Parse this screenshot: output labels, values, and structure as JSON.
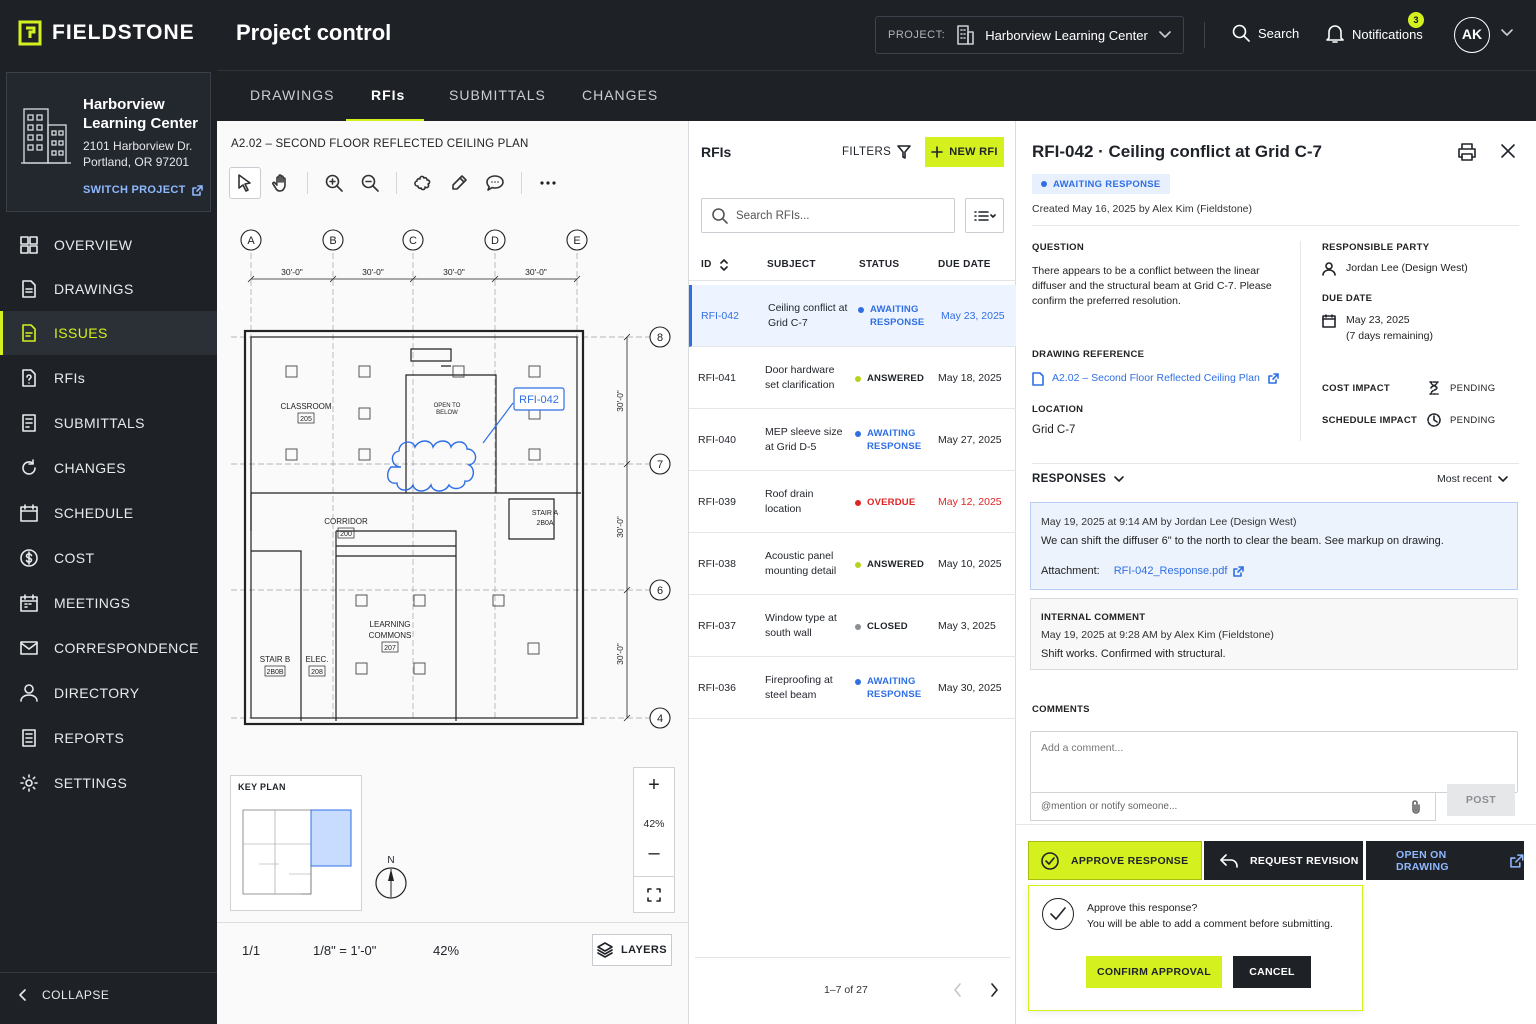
{
  "brand": {
    "name": "FIELDSTONE"
  },
  "header": {
    "title": "Project control",
    "project_label": "PROJECT:",
    "project_value": "Harborview Learning Center",
    "search": "Search",
    "notifications": "Notifications",
    "notif_count": "3",
    "avatar": "AK"
  },
  "sidebar": {
    "project_name": "Harborview Learning Center",
    "address_line1": "2101 Harborview Dr.",
    "address_line2": "Portland, OR 97201",
    "switch": "SWITCH PROJECT",
    "items": [
      {
        "label": "OVERVIEW",
        "icon": "grid-icon"
      },
      {
        "label": "DRAWINGS",
        "icon": "document-icon"
      },
      {
        "label": "ISSUES",
        "icon": "issues-icon"
      },
      {
        "label": "RFIs",
        "icon": "rfi-icon"
      },
      {
        "label": "SUBMITTALS",
        "icon": "submittal-icon"
      },
      {
        "label": "CHANGES",
        "icon": "changes-icon"
      },
      {
        "label": "SCHEDULE",
        "icon": "calendar-icon"
      },
      {
        "label": "COST",
        "icon": "dollar-icon"
      },
      {
        "label": "MEETINGS",
        "icon": "meetings-icon"
      },
      {
        "label": "CORRESPONDENCE",
        "icon": "mail-icon"
      },
      {
        "label": "DIRECTORY",
        "icon": "person-icon"
      },
      {
        "label": "REPORTS",
        "icon": "report-icon"
      },
      {
        "label": "SETTINGS",
        "icon": "gear-icon"
      }
    ],
    "active": "ISSUES",
    "collapse": "COLLAPSE"
  },
  "tabs": [
    "DRAWINGS",
    "RFIs",
    "SUBMITTALS",
    "CHANGES"
  ],
  "active_tab": "RFIs",
  "drawing": {
    "sheet_title": "A2.02 – SECOND FLOOR REFLECTED CEILING PLAN",
    "grid_cols": [
      "A",
      "B",
      "C",
      "D",
      "E"
    ],
    "grid_rows": [
      "8",
      "7",
      "6",
      "4"
    ],
    "dim_h": [
      "30'-0\"",
      "30'-0\"",
      "30'-0\"",
      "30'-0\""
    ],
    "dim_v": [
      "30'-0\"",
      "30'-0\"",
      "30'-0\""
    ],
    "rooms": {
      "classroom": "CLASSROOM",
      "classroom_no": "205",
      "open_below_1": "OPEN TO",
      "open_below_2": "BELOW",
      "corridor": "CORRIDOR",
      "corridor_no": "200",
      "learning_1": "LEARNING",
      "learning_2": "COMMONS",
      "learning_no": "207",
      "stair_b": "STAIR B",
      "stair_b_no": "2B0B",
      "elec": "ELEC.",
      "elec_no": "208",
      "stair_a": "STAIR A",
      "stair_a_no": "2B0A"
    },
    "markup_tag": "RFI-042",
    "key_plan": "KEY PLAN",
    "north": "N",
    "zoom": "42%",
    "page": "1/1",
    "scale": "1/8\" = 1'-0\"",
    "zoom_status": "42%",
    "layers": "LAYERS"
  },
  "rfi_list": {
    "title": "RFIs",
    "filters": "FILTERS",
    "new": "NEW RFI",
    "search_placeholder": "Search RFIs...",
    "columns": {
      "id": "ID",
      "subject": "SUBJECT",
      "status": "STATUS",
      "due": "DUE DATE"
    },
    "rows": [
      {
        "id": "RFI-042",
        "subject": "Ceiling conflict at Grid C-7",
        "status": "AWAITING RESPONSE",
        "status_color": "#2f6fe4",
        "due": "May 23, 2025"
      },
      {
        "id": "RFI-041",
        "subject": "Door hardware set clarification",
        "status": "ANSWERED",
        "status_color": "#b5d51a",
        "due": "May 18, 2025"
      },
      {
        "id": "RFI-040",
        "subject": "MEP sleeve size at Grid D-5",
        "status": "AWAITING RESPONSE",
        "status_color": "#2f6fe4",
        "due": "May 27, 2025"
      },
      {
        "id": "RFI-039",
        "subject": "Roof drain location",
        "status": "OVERDUE",
        "status_color": "#e02424",
        "due": "May 12, 2025"
      },
      {
        "id": "RFI-038",
        "subject": "Acoustic panel mounting detail",
        "status": "ANSWERED",
        "status_color": "#b5d51a",
        "due": "May 10, 2025"
      },
      {
        "id": "RFI-037",
        "subject": "Window type at south wall",
        "status": "CLOSED",
        "status_color": "#8a8f94",
        "due": "May 3, 2025"
      },
      {
        "id": "RFI-036",
        "subject": "Fireproofing at steel beam",
        "status": "AWAITING RESPONSE",
        "status_color": "#2f6fe4",
        "due": "May 30, 2025"
      }
    ],
    "pager": "1–7 of 27"
  },
  "detail": {
    "title": "RFI-042 · Ceiling conflict at Grid C-7",
    "badge": "AWAITING RESPONSE",
    "created": "Created May 16, 2025 by Alex Kim (Fieldstone)",
    "question_label": "QUESTION",
    "question": "There appears to be a conflict between the linear diffuser and the structural beam at Grid C-7. Please confirm the preferred resolution.",
    "responsible_label": "RESPONSIBLE PARTY",
    "responsible": "Jordan Lee (Design West)",
    "due_label": "DUE DATE",
    "due": "May 23, 2025",
    "due_remaining": "(7 days remaining)",
    "drawing_ref_label": "DRAWING REFERENCE",
    "drawing_ref": "A2.02 – Second Floor Reflected Ceiling Plan",
    "cost_label": "COST IMPACT",
    "cost": "PENDING",
    "schedule_label": "SCHEDULE IMPACT",
    "schedule": "PENDING",
    "location_label": "LOCATION",
    "location": "Grid C-7",
    "responses_label": "RESPONSES",
    "sort": "Most recent",
    "response": {
      "meta": "May 19, 2025 at 9:14 AM by Jordan Lee (Design West)",
      "text": "We can shift the diffuser 6\" to the north to clear the beam. See markup on drawing.",
      "attach_label": "Attachment:",
      "attach": "RFI-042_Response.pdf"
    },
    "internal": {
      "label": "INTERNAL COMMENT",
      "meta": "May 19, 2025 at 9:28 AM by Alex Kim (Fieldstone)",
      "text": "Shift works. Confirmed with structural."
    },
    "comments_label": "COMMENTS",
    "comment_placeholder": "Add a comment...",
    "mention_placeholder": "@mention or notify someone...",
    "post": "POST",
    "approve": "APPROVE RESPONSE",
    "revision": "REQUEST REVISION",
    "open_drawing": "OPEN ON DRAWING",
    "confirm_q": "Approve this response?",
    "confirm_sub": "You will be able to add a comment before submitting.",
    "confirm": "CONFIRM APPROVAL",
    "cancel": "CANCEL"
  },
  "colors": {
    "accent": "#d4f01f",
    "dark": "#1e2227",
    "link": "#2f6fe4",
    "overdue": "#e02424"
  }
}
